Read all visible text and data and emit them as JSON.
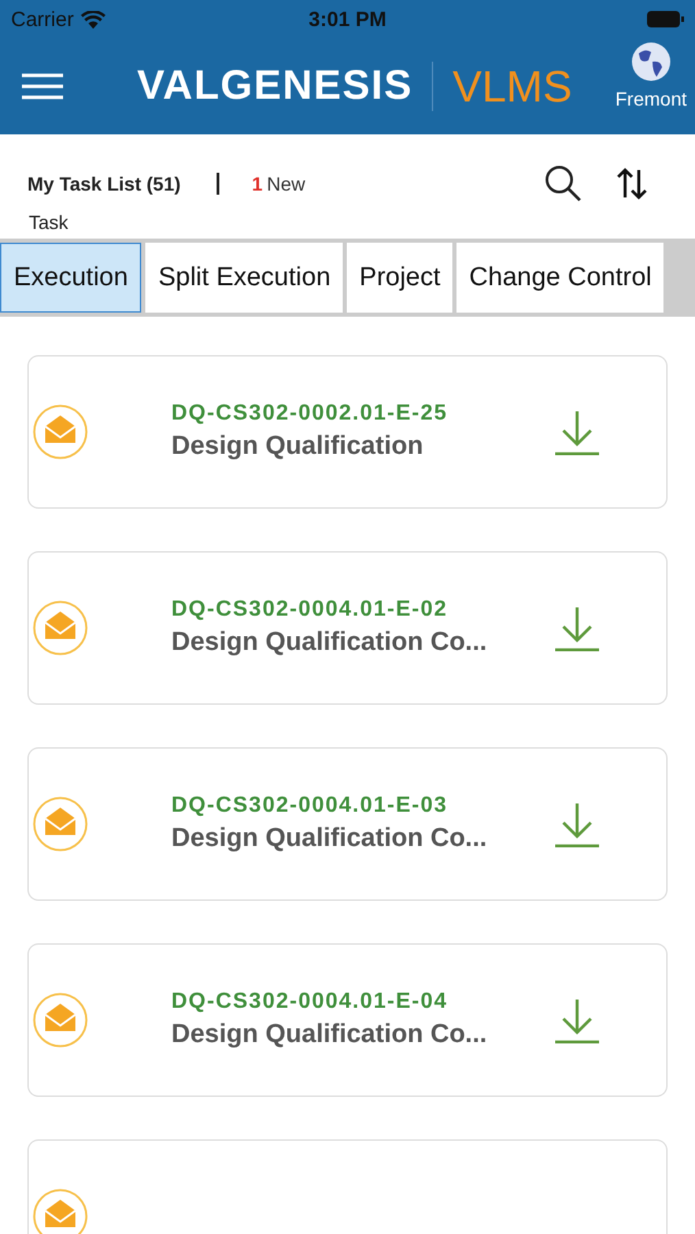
{
  "status_bar": {
    "carrier": "Carrier",
    "time": "3:01 PM"
  },
  "header": {
    "logo": "VALGENESIS",
    "product": "VLMS",
    "location": "Fremont"
  },
  "toolbar": {
    "title": "My Task List (51)",
    "new_count": "1",
    "new_label": "New"
  },
  "section_label": "Task",
  "tabs": [
    {
      "label": "Execution",
      "selected": true
    },
    {
      "label": "Split Execution",
      "selected": false
    },
    {
      "label": "Project",
      "selected": false
    },
    {
      "label": "Change Control",
      "selected": false
    }
  ],
  "tasks": [
    {
      "code": "DQ-CS302-0002.01-E-25",
      "name": "Design Qualification"
    },
    {
      "code": "DQ-CS302-0004.01-E-02",
      "name": "Design Qualification Co..."
    },
    {
      "code": "DQ-CS302-0004.01-E-03",
      "name": "Design Qualification Co..."
    },
    {
      "code": "DQ-CS302-0004.01-E-04",
      "name": "Design Qualification Co..."
    }
  ]
}
